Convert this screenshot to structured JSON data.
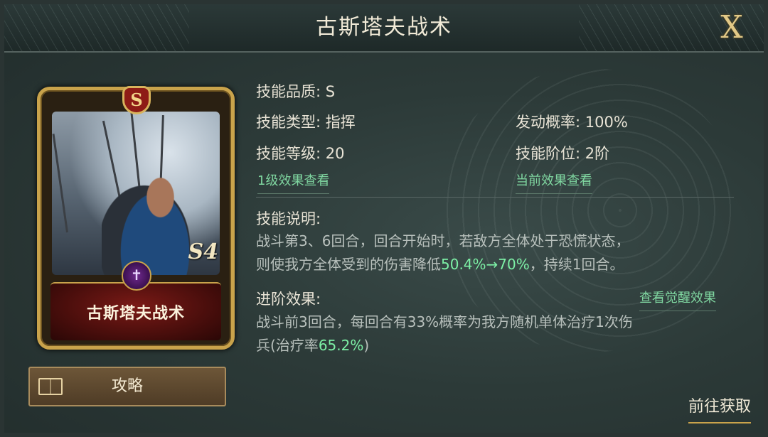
{
  "dialog": {
    "title": "古斯塔夫战术",
    "close_label": "X"
  },
  "card": {
    "quality_badge": "S",
    "rank_text": "S4",
    "name": "古斯塔夫战术"
  },
  "guide_button": {
    "label": "攻略",
    "icon": "book-icon"
  },
  "skill": {
    "quality": "技能品质: S",
    "type": "技能类型: 指挥",
    "trigger_rate": "发动概率: 100%",
    "level": "技能等级: 20",
    "tier": "技能阶位: 2阶",
    "link_level1": "1级效果查看",
    "link_current": "当前效果查看"
  },
  "description": {
    "heading": "技能说明:",
    "line1": "战斗第3、6回合，回合开始时，若敌方全体处于恐慌状态，",
    "line2_prefix": "则使我方全体受到的伤害降低",
    "line2_highlight": "50.4%→70%",
    "line2_suffix": "，持续1回合。"
  },
  "advance": {
    "heading": "进阶效果:",
    "awaken_link": "查看觉醒效果",
    "line1": "战斗前3回合，每回合有33%概率为我方随机单体治疗1次伤",
    "line2_prefix": "兵(治疗率",
    "line2_highlight": "65.2%",
    "line2_suffix": ")"
  },
  "goto_button": "前往获取",
  "colors": {
    "highlight": "#7df0a6",
    "gold": "#c9a34b",
    "link": "#7fd6a0"
  }
}
